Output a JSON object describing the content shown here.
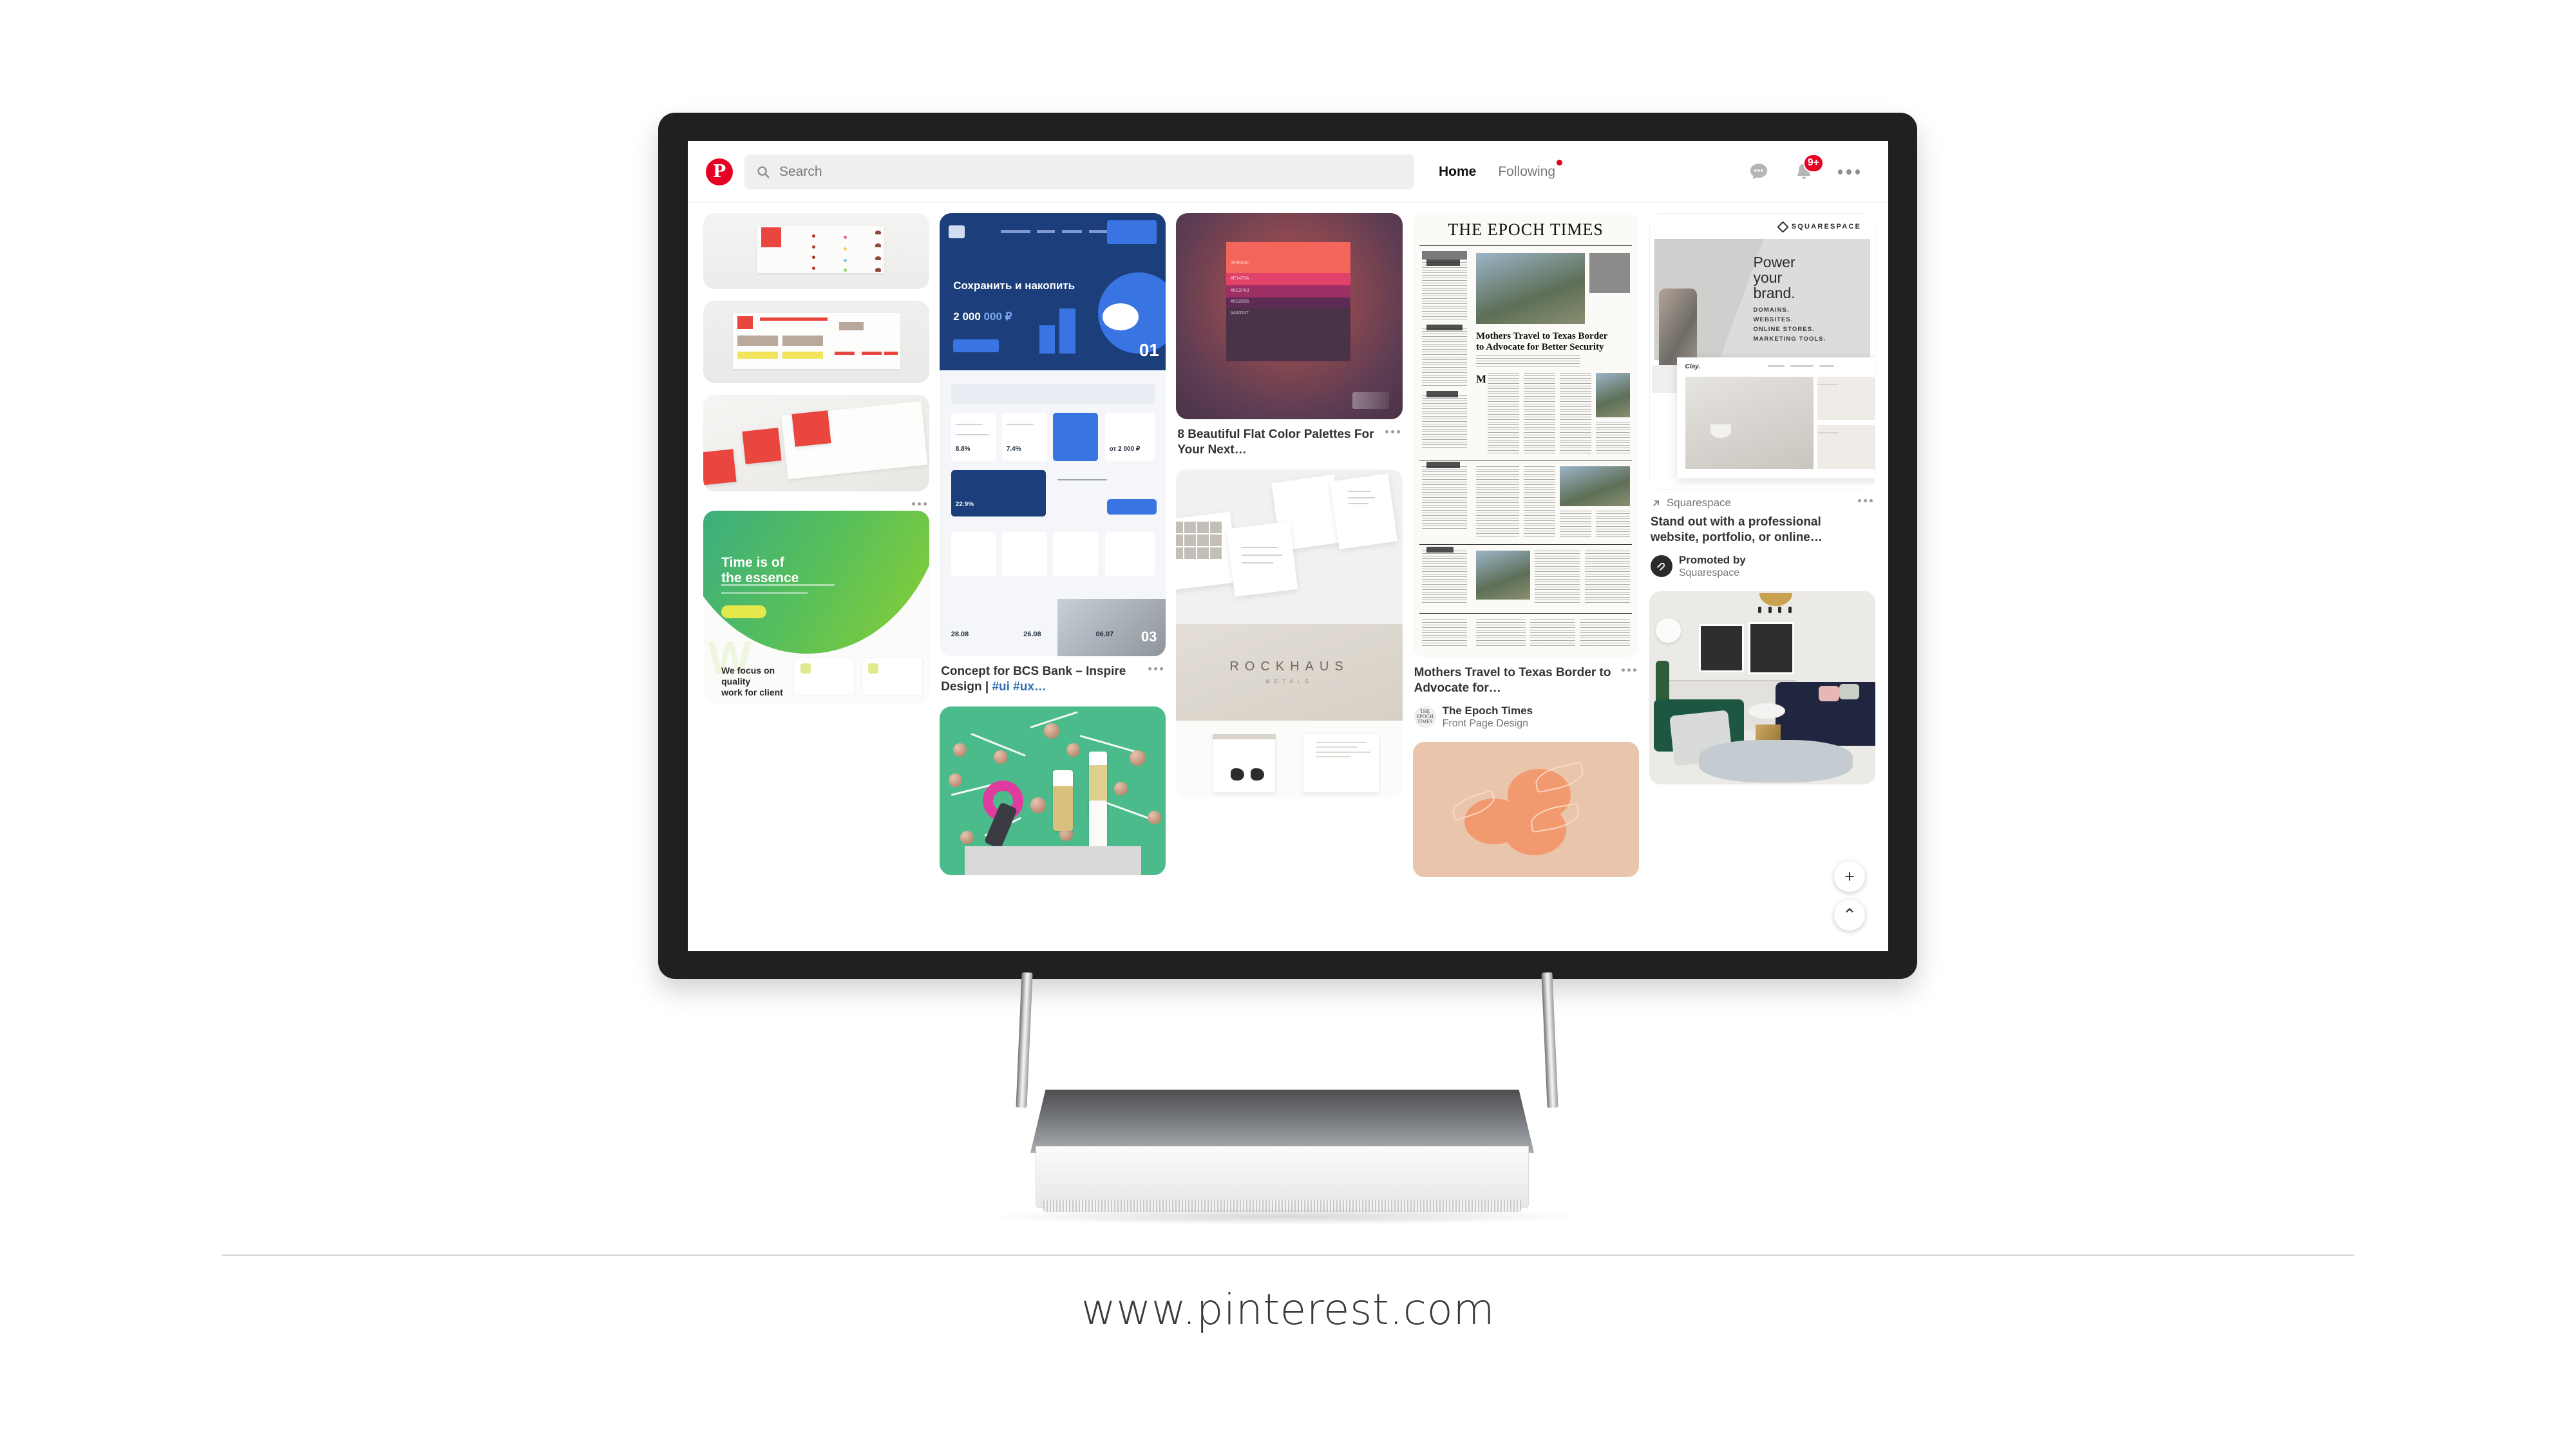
{
  "site": {
    "url_label": "www.pinterest.com"
  },
  "nav": {
    "logo_icon": "pinterest-logo-icon",
    "logo_glyph": "P",
    "search": {
      "placeholder": "Search",
      "value": "",
      "icon": "search-icon"
    },
    "links": [
      {
        "label": "Home",
        "active": true,
        "dot": false
      },
      {
        "label": "Following",
        "active": false,
        "dot": true
      }
    ],
    "actions": [
      {
        "name": "messages-icon",
        "label": ""
      },
      {
        "name": "notifications-icon",
        "badge": "9+"
      },
      {
        "name": "more-options-icon",
        "label": ""
      }
    ]
  },
  "fabs": {
    "add": {
      "icon": "plus-icon",
      "glyph": "+"
    },
    "scroll_up": {
      "icon": "chevron-up-icon",
      "glyph": "⌃"
    }
  },
  "pins": {
    "col1": {
      "pin1": {
        "title": "",
        "media": "japanese-brochure-mockups"
      },
      "pin2": {
        "title": "",
        "media": "green-gradient-website"
      }
    },
    "col2": {
      "pin1": {
        "title_main": "Concept for BCS Bank – Inspire Design | ",
        "title_hash": "#ui #ux…",
        "media": "bcs-bank-ui-concept",
        "hero_heading": "Сохранить и накопить",
        "hero_amount": "2 000",
        "hero_amount_faint": "000 ₽",
        "hero_number": "01",
        "second_number": "03",
        "stat1": "8.8%",
        "stat2": "7.4%",
        "stat3": "от 2 000 ₽",
        "stat4": "22.9%",
        "date1": "28.08",
        "date2": "26.08",
        "date3": "06.07"
      },
      "pin2": {
        "title": "",
        "media": "green-flatlay-beauty-products"
      }
    },
    "col3": {
      "pin1": {
        "title": "8 Beautiful Flat Color Palettes For Your Next…",
        "media": "flat-color-palette-swatches",
        "swatches": [
          "#f4655c",
          "#e1426a",
          "#9c2f63",
          "#5d2b55",
          "#4a3247"
        ]
      },
      "pin2": {
        "title": "",
        "media": "rockhaus-brochure-mockups",
        "wordmark": "ROCKHAUS",
        "wordmark_sub": "METALS"
      }
    },
    "col4": {
      "pin1": {
        "title": "Mothers Travel to Texas Border to Advocate for…",
        "media": "epoch-times-front-page",
        "masthead": "THE EPOCH TIMES",
        "headline": "Mothers Travel to Texas Border to Advocate for Better Security",
        "attribution": {
          "name": "The Epoch Times",
          "board": "Front Page Design",
          "avatar": "epoch-times-avatar",
          "avatar_text": "THE EPOCH TIMES"
        }
      },
      "pin2": {
        "title": "",
        "media": "peach-line-art-illustration"
      }
    },
    "col5": {
      "pin1": {
        "source_label": "Squarespace",
        "source_icon": "external-link-icon",
        "title": "Stand out with a professional website, portfolio, or online…",
        "media": "squarespace-promoted-ad",
        "ad_brand": "SQUARESPACE",
        "ad_heading": "Power your brand.",
        "ad_bullets": [
          "DOMAINS.",
          "WEBSITES.",
          "ONLINE STORES.",
          "MARKETING TOOLS."
        ],
        "ad_site_logo": "Clay.",
        "attribution": {
          "name": "Promoted by",
          "board": "Squarespace",
          "avatar": "squarespace-avatar"
        }
      },
      "pin2": {
        "title": "",
        "media": "living-room-interior-photo"
      }
    }
  },
  "colors": {
    "brand_red": "#e60023",
    "text_dark": "#333333",
    "text_muted": "#767676",
    "link_blue": "#2f6fb0",
    "bezel": "#1f2020"
  }
}
